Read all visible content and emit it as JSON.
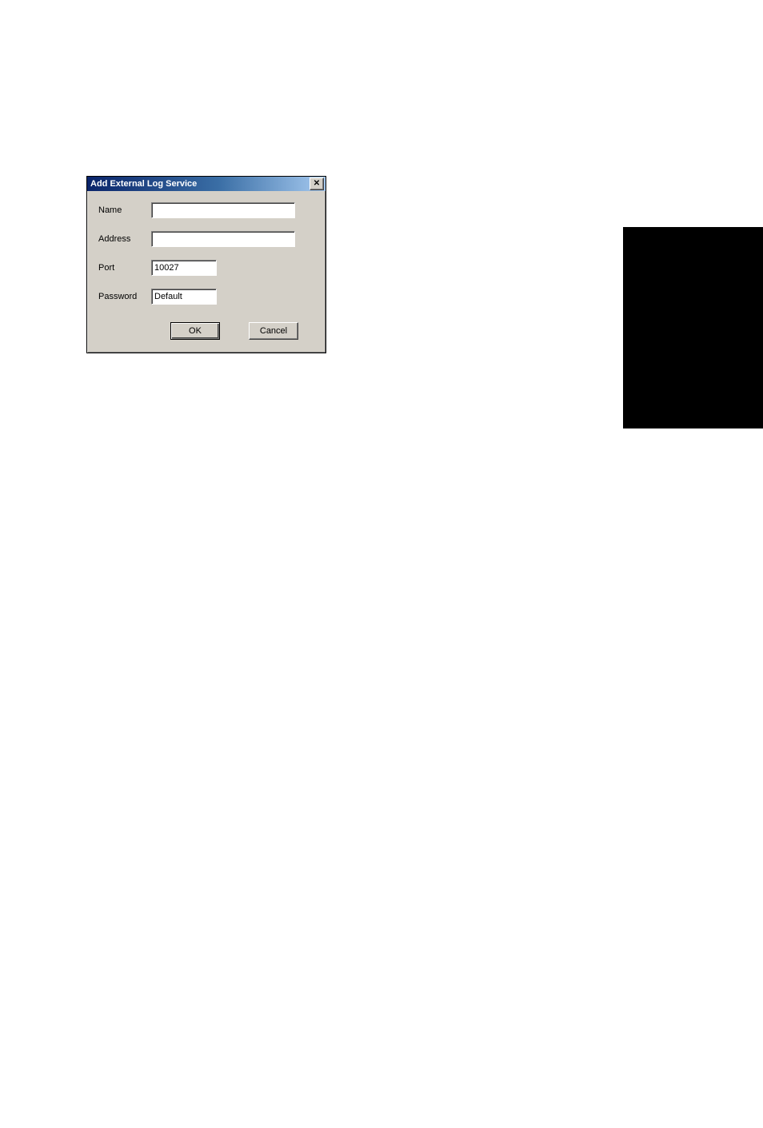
{
  "dialog": {
    "title": "Add External Log Service",
    "fields": {
      "name": {
        "label": "Name",
        "value": ""
      },
      "address": {
        "label": "Address",
        "value": ""
      },
      "port": {
        "label": "Port",
        "value": "10027"
      },
      "password": {
        "label": "Password",
        "value": "Default"
      }
    },
    "buttons": {
      "ok": "OK",
      "cancel": "Cancel"
    }
  }
}
